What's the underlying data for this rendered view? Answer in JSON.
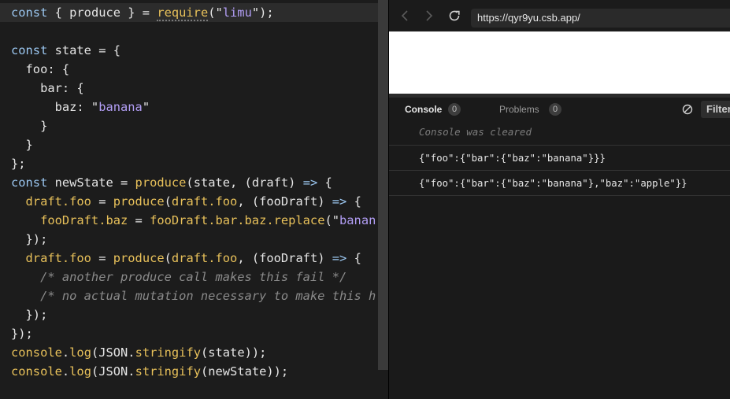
{
  "editor": {
    "lines": [
      [
        {
          "t": "const",
          "c": "kw"
        },
        {
          "t": " { produce } = ",
          "c": "plain"
        },
        {
          "t": "require",
          "c": "fn",
          "u": true
        },
        {
          "t": "(\"",
          "c": "plain"
        },
        {
          "t": "limu",
          "c": "str"
        },
        {
          "t": "\");",
          "c": "plain"
        }
      ],
      [],
      [
        {
          "t": "const",
          "c": "kw"
        },
        {
          "t": " state = {",
          "c": "plain"
        }
      ],
      [
        {
          "t": "  foo: {",
          "c": "plain"
        }
      ],
      [
        {
          "t": "    bar: {",
          "c": "plain"
        }
      ],
      [
        {
          "t": "      baz: \"",
          "c": "plain"
        },
        {
          "t": "banana",
          "c": "str"
        },
        {
          "t": "\"",
          "c": "plain"
        }
      ],
      [
        {
          "t": "    }",
          "c": "plain"
        }
      ],
      [
        {
          "t": "  }",
          "c": "plain"
        }
      ],
      [
        {
          "t": "};",
          "c": "plain"
        }
      ],
      [
        {
          "t": "const",
          "c": "kw"
        },
        {
          "t": " newState = ",
          "c": "plain"
        },
        {
          "t": "produce",
          "c": "fn"
        },
        {
          "t": "(state, (draft) ",
          "c": "plain"
        },
        {
          "t": "=>",
          "c": "op"
        },
        {
          "t": " {",
          "c": "plain"
        }
      ],
      [
        {
          "t": "  draft.foo",
          "c": "fn"
        },
        {
          "t": " = ",
          "c": "plain"
        },
        {
          "t": "produce",
          "c": "fn"
        },
        {
          "t": "(",
          "c": "plain"
        },
        {
          "t": "draft.foo",
          "c": "fn"
        },
        {
          "t": ", (fooDraft) ",
          "c": "plain"
        },
        {
          "t": "=>",
          "c": "op"
        },
        {
          "t": " {",
          "c": "plain"
        }
      ],
      [
        {
          "t": "    fooDraft.baz",
          "c": "fn"
        },
        {
          "t": " = ",
          "c": "plain"
        },
        {
          "t": "fooDraft.bar.baz.replace",
          "c": "fn"
        },
        {
          "t": "(\"",
          "c": "plain"
        },
        {
          "t": "banan",
          "c": "str"
        }
      ],
      [
        {
          "t": "  });",
          "c": "plain"
        }
      ],
      [
        {
          "t": "  draft.foo",
          "c": "fn"
        },
        {
          "t": " = ",
          "c": "plain"
        },
        {
          "t": "produce",
          "c": "fn"
        },
        {
          "t": "(",
          "c": "plain"
        },
        {
          "t": "draft.foo",
          "c": "fn"
        },
        {
          "t": ", (fooDraft) ",
          "c": "plain"
        },
        {
          "t": "=>",
          "c": "op"
        },
        {
          "t": " {",
          "c": "plain"
        }
      ],
      [
        {
          "t": "    /* another produce call makes this fail */",
          "c": "cm"
        }
      ],
      [
        {
          "t": "    /* no actual mutation necessary to make this h",
          "c": "cm"
        }
      ],
      [
        {
          "t": "  });",
          "c": "plain"
        }
      ],
      [
        {
          "t": "});",
          "c": "plain"
        }
      ],
      [
        {
          "t": "console",
          "c": "fn"
        },
        {
          "t": ".",
          "c": "plain"
        },
        {
          "t": "log",
          "c": "fn"
        },
        {
          "t": "(JSON.",
          "c": "plain"
        },
        {
          "t": "stringify",
          "c": "fn"
        },
        {
          "t": "(state));",
          "c": "plain"
        }
      ],
      [
        {
          "t": "console",
          "c": "fn"
        },
        {
          "t": ".",
          "c": "plain"
        },
        {
          "t": "log",
          "c": "fn"
        },
        {
          "t": "(JSON.",
          "c": "plain"
        },
        {
          "t": "stringify",
          "c": "fn"
        },
        {
          "t": "(newState));",
          "c": "plain"
        }
      ]
    ]
  },
  "browser": {
    "url": "https://qyr9yu.csb.app/",
    "back_icon": "chevron-left-icon",
    "forward_icon": "chevron-right-icon",
    "reload_icon": "reload-icon"
  },
  "console": {
    "tabs": [
      {
        "label": "Console",
        "count": "0"
      },
      {
        "label": "Problems",
        "count": "0"
      }
    ],
    "clear_icon": "clear-console-icon",
    "filter_label": "Filter",
    "cleared_message": "Console was cleared",
    "logs": [
      "{\"foo\":{\"bar\":{\"baz\":\"banana\"}}}",
      "{\"foo\":{\"bar\":{\"baz\":\"banana\"},\"baz\":\"apple\"}}"
    ]
  },
  "colors": {
    "keyword": "#9cc8f2",
    "function": "#e8c15a",
    "string": "#b29ef5",
    "comment": "#8a8a8a"
  }
}
